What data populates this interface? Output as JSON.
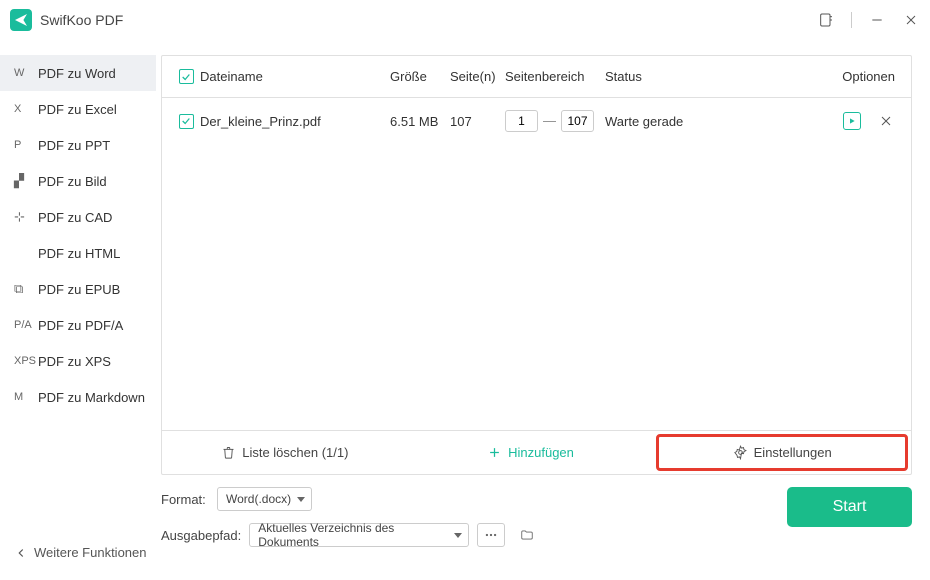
{
  "app_name": "SwifKoo PDF",
  "sidebar": {
    "items": [
      {
        "abbr": "W",
        "label": "PDF zu Word",
        "active": true
      },
      {
        "abbr": "X",
        "label": "PDF zu Excel",
        "active": false
      },
      {
        "abbr": "P",
        "label": "PDF zu PPT",
        "active": false
      },
      {
        "abbr": "img",
        "label": "PDF zu Bild",
        "active": false
      },
      {
        "abbr": "cad",
        "label": "PDF zu CAD",
        "active": false
      },
      {
        "abbr": "</>",
        "label": "PDF zu HTML",
        "active": false
      },
      {
        "abbr": "E",
        "label": "PDF zu EPUB",
        "active": false
      },
      {
        "abbr": "P/A",
        "label": "PDF zu PDF/A",
        "active": false
      },
      {
        "abbr": "XPS",
        "label": "PDF zu XPS",
        "active": false
      },
      {
        "abbr": "M",
        "label": "PDF zu Markdown",
        "active": false
      }
    ],
    "more_functions": "Weitere Funktionen"
  },
  "columns": {
    "name": "Dateiname",
    "size": "Größe",
    "pages": "Seite(n)",
    "range": "Seitenbereich",
    "status": "Status",
    "options": "Optionen"
  },
  "rows": [
    {
      "name": "Der_kleine_Prinz.pdf",
      "size": "6.51 MB",
      "pages": "107",
      "range_from": "1",
      "range_to": "107",
      "status": "Warte gerade"
    }
  ],
  "actions": {
    "clear": "Liste löschen (1/1)",
    "add": "Hinzufügen",
    "settings": "Einstellungen"
  },
  "bottom": {
    "format_label": "Format:",
    "format_value": "Word(.docx)",
    "outpath_label": "Ausgabepfad:",
    "outpath_value": "Aktuelles Verzeichnis des Dokuments",
    "start": "Start"
  }
}
